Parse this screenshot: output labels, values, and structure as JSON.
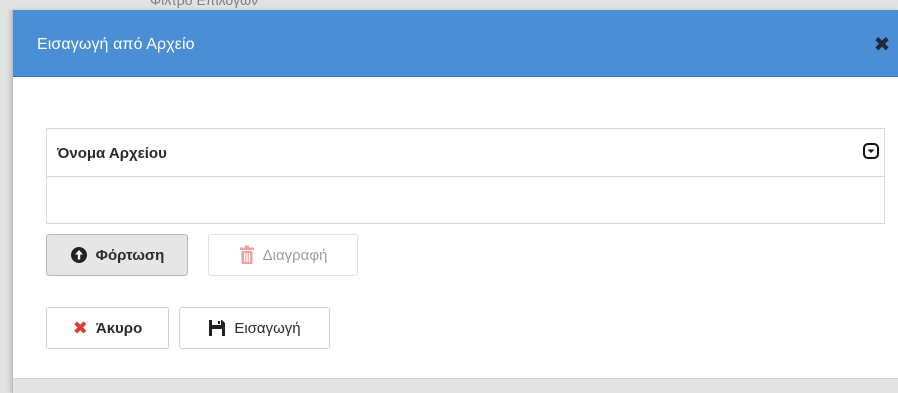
{
  "background": {
    "peek_text": "Φίλτρο Επιλογών"
  },
  "dialog": {
    "title": "Εισαγωγή από Αρχείο",
    "close_icon": "close-icon",
    "table": {
      "columns": [
        {
          "label": "Όνομα Αρχείου"
        }
      ],
      "rows": []
    },
    "buttons": {
      "upload": {
        "label": "Φόρτωση",
        "icon": "upload-circle-icon"
      },
      "delete": {
        "label": "Διαγραφή",
        "icon": "trash-icon",
        "disabled": true
      },
      "cancel": {
        "label": "Άκυρο",
        "icon": "x-icon"
      },
      "insert": {
        "label": "Εισαγωγή",
        "icon": "save-icon"
      }
    }
  },
  "colors": {
    "titlebar": "#4a8ed6",
    "cancel_icon": "#e03a2e",
    "trash_icon": "#f0a0a0"
  }
}
